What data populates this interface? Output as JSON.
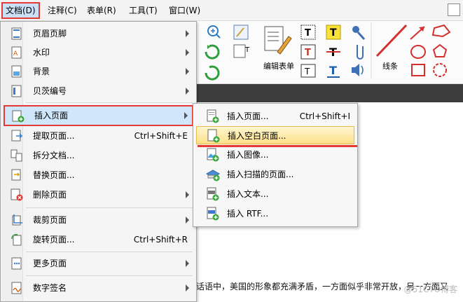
{
  "menubar": {
    "items": [
      "文档(D)",
      "注释(C)",
      "表单(R)",
      "工具(T)",
      "窗口(W)"
    ]
  },
  "ribbon": {
    "edit_form_label": "编辑表单",
    "line_label": "线条",
    "text_tool_label": "T"
  },
  "document": {
    "snippet": "话语中，美国的形象都充满矛盾，一方面似乎非常开放，另一方面又",
    "watermark": "@51CTO博客"
  },
  "menu": {
    "items": [
      {
        "label": "页眉页脚",
        "shortcut": "",
        "submenu": true
      },
      {
        "label": "水印",
        "shortcut": "",
        "submenu": true
      },
      {
        "label": "背景",
        "shortcut": "",
        "submenu": true
      },
      {
        "label": "贝茨编号",
        "shortcut": "",
        "submenu": true
      },
      {
        "label": "插入页面",
        "shortcut": "",
        "submenu": true
      },
      {
        "label": "提取页面...",
        "shortcut": "Ctrl+Shift+E",
        "submenu": false
      },
      {
        "label": "拆分文档...",
        "shortcut": "",
        "submenu": false
      },
      {
        "label": "替换页面...",
        "shortcut": "",
        "submenu": false
      },
      {
        "label": "删除页面",
        "shortcut": "",
        "submenu": true
      },
      {
        "label": "裁剪页面",
        "shortcut": "",
        "submenu": true
      },
      {
        "label": "旋转页面...",
        "shortcut": "Ctrl+Shift+R",
        "submenu": false
      },
      {
        "label": "更多页面",
        "shortcut": "",
        "submenu": true
      },
      {
        "label": "数字签名",
        "shortcut": "",
        "submenu": true
      }
    ]
  },
  "submenu": {
    "items": [
      {
        "label": "插入页面...",
        "shortcut": "Ctrl+Shift+I"
      },
      {
        "label": "插入空白页面...",
        "shortcut": ""
      },
      {
        "label": "插入图像...",
        "shortcut": ""
      },
      {
        "label": "插入扫描的页面...",
        "shortcut": ""
      },
      {
        "label": "插入文本...",
        "shortcut": ""
      },
      {
        "label": "插入 RTF...",
        "shortcut": ""
      }
    ]
  },
  "colors": {
    "highlight_border": "#e53935",
    "menu_highlight": "#cfe6fb",
    "submenu_highlight": "#fde08a"
  }
}
